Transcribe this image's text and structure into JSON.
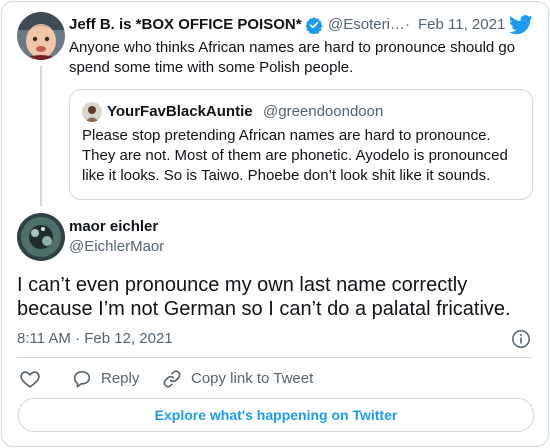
{
  "reply_to": {
    "display_name": "Jeff B. is *BOX OFFICE POISON*",
    "handle": "@Esoteri…",
    "separator": "·",
    "date": "Feb 11, 2021",
    "text": "Anyone who thinks African names are hard to pronounce should go spend some time with some Polish people.",
    "verified": true
  },
  "quoted": {
    "display_name": "YourFavBlackAuntie",
    "handle": "@greendoondoon",
    "text": "Please stop pretending African names are hard to pronounce. They are not. Most of them are phonetic. Ayodelo is pronounced like it looks. So is Taiwo. Phoebe don’t look shit like it sounds."
  },
  "main": {
    "display_name": "maor eichler",
    "handle": "@EichlerMaor",
    "text": "I can’t even pronounce my own last name correctly because I’m not German so I can’t do a palatal fricative.",
    "timestamp": "8:11 AM · Feb 12, 2021"
  },
  "actions": {
    "reply_label": "Reply",
    "copy_link_label": "Copy link to Tweet"
  },
  "cta_label": "Explore what's happening on Twitter",
  "colors": {
    "accent": "#1d9bf0",
    "muted": "#536471",
    "border": "#cfd9de",
    "text": "#0f1419"
  },
  "icons": [
    "twitter-bird-icon",
    "verified-badge-icon",
    "info-icon",
    "heart-icon",
    "reply-bubble-icon",
    "link-icon"
  ]
}
